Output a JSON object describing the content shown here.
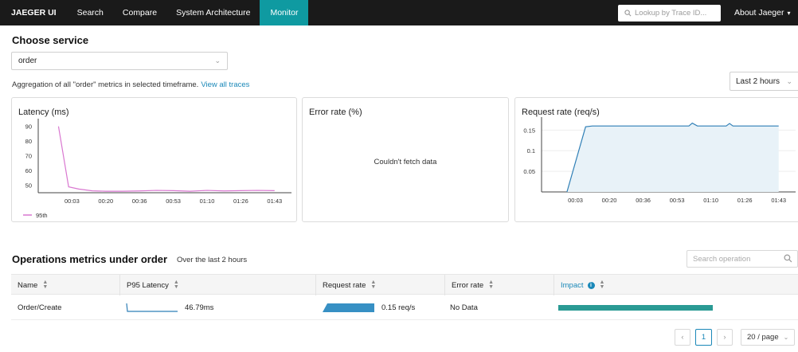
{
  "nav": {
    "brand": "JAEGER UI",
    "items": [
      "Search",
      "Compare",
      "System Architecture",
      "Monitor"
    ],
    "active": "Monitor",
    "search_placeholder": "Lookup by Trace ID...",
    "about": "About Jaeger"
  },
  "service": {
    "heading": "Choose service",
    "selected": "order",
    "aggregation_text": "Aggregation of all \"order\" metrics in selected timeframe.",
    "view_all_link": "View all traces",
    "timeframe": "Last 2 hours"
  },
  "cards": {
    "latency_title": "Latency (ms)",
    "error_title": "Error rate (%)",
    "error_message": "Couldn't fetch data",
    "request_title": "Request rate (req/s)"
  },
  "chart_data": [
    {
      "type": "line",
      "title": "Latency (ms)",
      "x_ticks": [
        "00:03",
        "00:20",
        "00:36",
        "00:53",
        "01:10",
        "01:26",
        "01:43"
      ],
      "y_ticks": [
        50,
        60,
        70,
        80,
        90
      ],
      "ylim": [
        45,
        92
      ],
      "color": "#d977d0",
      "series": [
        {
          "name": "95th",
          "x": [
            0.6,
            0.9,
            1.2,
            1.6,
            2.0,
            2.5,
            3.0,
            3.5,
            4.0,
            4.5,
            5.0,
            5.5,
            6.0,
            6.5,
            7.0
          ],
          "y": [
            90,
            49,
            47.5,
            46.3,
            46.0,
            46.0,
            46.2,
            46.6,
            46.4,
            46.0,
            46.6,
            46.2,
            46.4,
            46.6,
            46.4
          ]
        }
      ]
    },
    {
      "type": "area",
      "title": "Request rate (req/s)",
      "x_ticks": [
        "00:03",
        "00:20",
        "00:36",
        "00:53",
        "01:10",
        "01:26",
        "01:43"
      ],
      "y_ticks": [
        0.05,
        0.1,
        0.15
      ],
      "ylim": [
        0,
        0.17
      ],
      "color": "#2f7fb6",
      "fill": "#e8f2f8",
      "series": [
        {
          "x": [
            0.75,
            1.3,
            1.5,
            2.0,
            3.0,
            4.0,
            4.35,
            4.45,
            4.6,
            5.0,
            5.45,
            5.55,
            5.65,
            6.0,
            7.0
          ],
          "y": [
            0.0,
            0.158,
            0.16,
            0.16,
            0.16,
            0.16,
            0.16,
            0.167,
            0.16,
            0.16,
            0.16,
            0.166,
            0.16,
            0.16,
            0.16
          ]
        }
      ]
    }
  ],
  "operations": {
    "heading": "Operations metrics under order",
    "subheading": "Over the last 2 hours",
    "search_placeholder": "Search operation",
    "columns": [
      "Name",
      "P95 Latency",
      "Request rate",
      "Error rate",
      "Impact"
    ],
    "rows": [
      {
        "name": "Order/Create",
        "p95_latency": "46.79ms",
        "request_rate": "0.15 req/s",
        "error_rate": "No Data",
        "impact": 1.0
      }
    ]
  },
  "pagination": {
    "prev": "‹",
    "current": "1",
    "next": "›",
    "page_size": "20 / page"
  },
  "colors": {
    "accent": "#0f9aa1",
    "link": "#1a88b8",
    "latency_line": "#d977d0",
    "impact_bar": "#2a9a94"
  }
}
